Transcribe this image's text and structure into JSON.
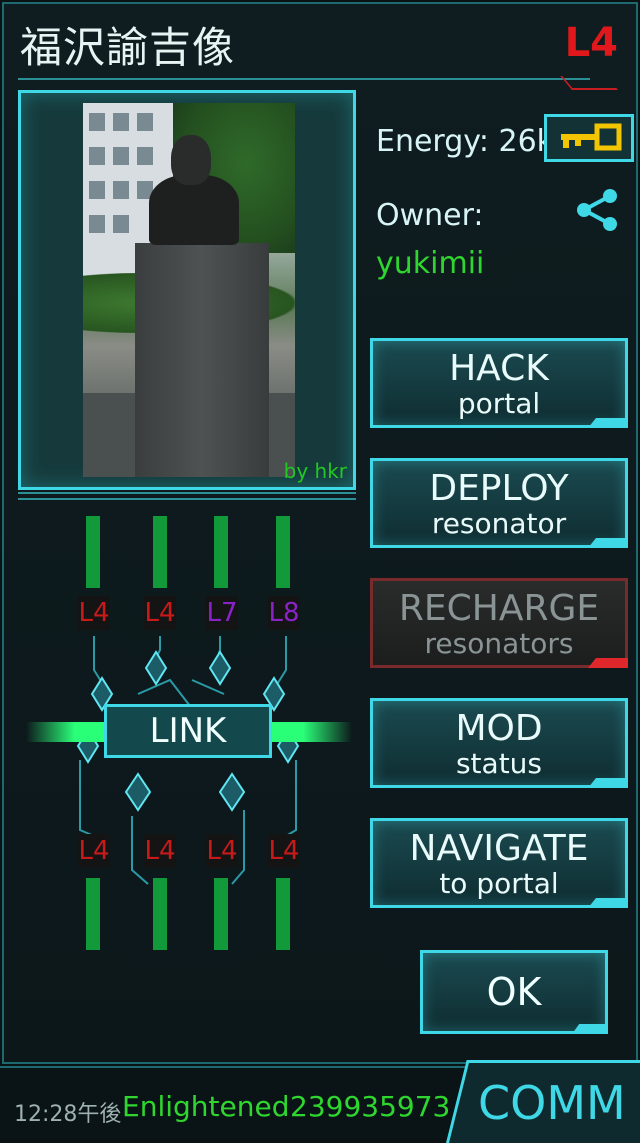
{
  "portal": {
    "title": "福沢諭吉像",
    "level": "L4",
    "photo_credit": "by hkr",
    "energy": "Energy: 26k",
    "owner_label": "Owner:",
    "owner": "yukimii"
  },
  "actions": [
    {
      "line1": "HACK",
      "line2": "portal",
      "enabled": true
    },
    {
      "line1": "DEPLOY",
      "line2": "resonator",
      "enabled": true
    },
    {
      "line1": "RECHARGE",
      "line2": "resonators",
      "enabled": false
    },
    {
      "line1": "MOD",
      "line2": "status",
      "enabled": true
    },
    {
      "line1": "NAVIGATE",
      "line2": "to portal",
      "enabled": true
    }
  ],
  "ok_label": "OK",
  "link_label": "LINK",
  "resonators": {
    "top": [
      "L4",
      "L4",
      "L7",
      "L8"
    ],
    "bottom": [
      "L4",
      "L4",
      "L4",
      "L4"
    ]
  },
  "status_bar": {
    "time": "12:28午後",
    "faction": "Enlightened",
    "score": "239935973",
    "comm": "COMM"
  },
  "colors": {
    "accent": "#3fd8e6",
    "enlightened": "#2fd62f",
    "level_red": "#e0181c",
    "l7_purple": "#8a22c8"
  },
  "icons": [
    "key-icon",
    "share-icon"
  ]
}
